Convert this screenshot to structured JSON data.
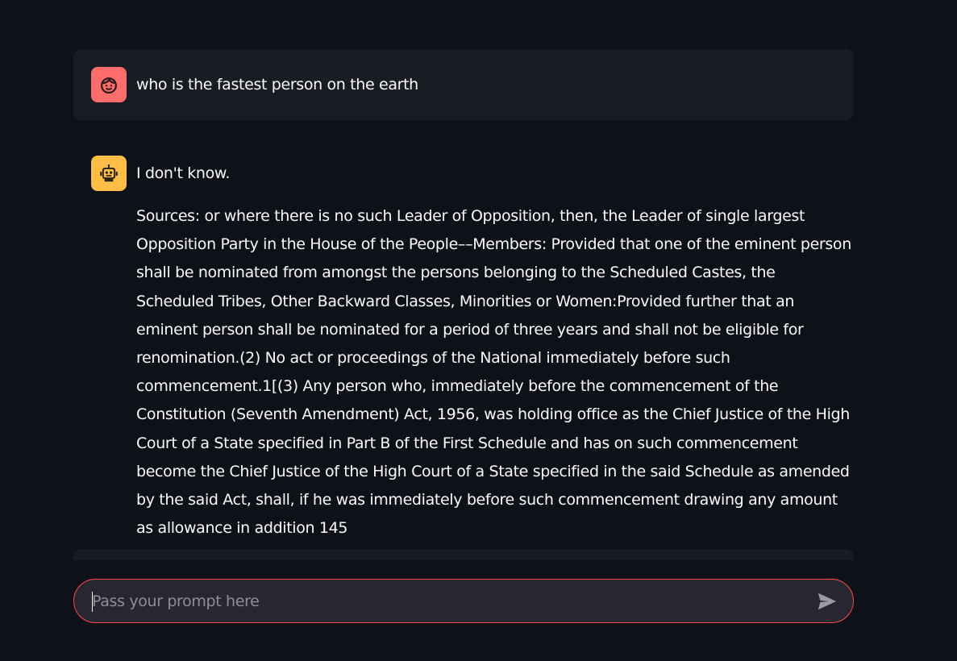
{
  "colors": {
    "background": "#0e1117",
    "message_bg": "#1a1c24",
    "user_avatar": "#ff6c6c",
    "bot_avatar": "#ffbd45",
    "input_border": "#ff4b4b",
    "input_bg": "#262730"
  },
  "messages": {
    "user": {
      "avatar_icon": "smiling-face-icon",
      "text": "who is the fastest person on the earth"
    },
    "assistant": {
      "avatar_icon": "robot-icon",
      "answer": "I don't know.",
      "sources": "Sources: or where there is no such Leader of Opposition, then, the Leader of single largest Opposition Party in the House of the People––Members: Provided that one of the eminent person shall be nominated from amongst the persons belonging to the Scheduled Castes, the Scheduled Tribes, Other Backward Classes, Minorities or Women:Provided further that an eminent person shall be nominated for a period of three years and shall not be eligible for renomination.(2) No act or proceedings of the National immediately before such commencement.1[(3) Any person who, immediately before the commencement of the Constitution (Seventh Amendment) Act, 1956, was holding office as the Chief Justice of the High Court of a State specified in Part B of the First Schedule and has on such commencement become the Chief Justice of the High Court of a State specified in the said Schedule as amended by the said Act, shall, if he was immediately before such commencement drawing any amount as allowance in addition 145"
    }
  },
  "chat_input": {
    "placeholder": "Pass your prompt here",
    "value": "",
    "send_icon": "send-arrow-icon"
  }
}
